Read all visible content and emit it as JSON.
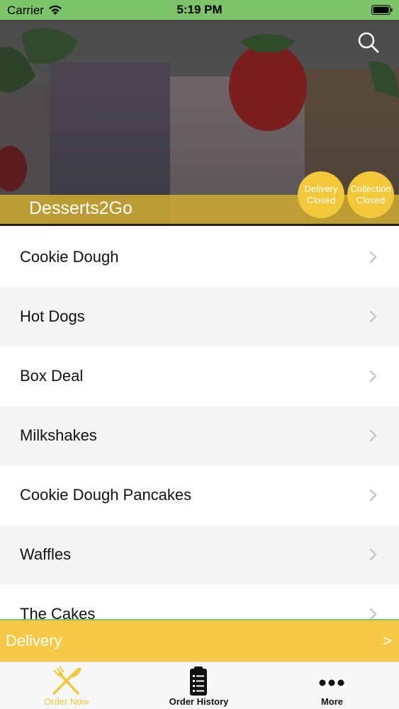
{
  "status_bar": {
    "carrier": "Carrier",
    "time": "5:19 PM"
  },
  "header": {
    "brand": "Desserts2Go",
    "badges": [
      {
        "line1": "Delivery",
        "line2": "Closed"
      },
      {
        "line1": "Collection",
        "line2": "Closed"
      }
    ]
  },
  "menu": {
    "items": [
      {
        "label": "Cookie Dough"
      },
      {
        "label": "Hot Dogs"
      },
      {
        "label": "Box Deal"
      },
      {
        "label": "Milkshakes"
      },
      {
        "label": "Cookie Dough Pancakes"
      },
      {
        "label": "Waffles"
      },
      {
        "label": "The Cakes"
      }
    ]
  },
  "delivery_bar": {
    "label": "Delivery",
    "arrow": ">"
  },
  "tabs": [
    {
      "label": "Order Now",
      "icon": "fork-knife-icon",
      "active": true
    },
    {
      "label": "Order History",
      "icon": "clipboard-list-icon",
      "active": false
    },
    {
      "label": "More",
      "icon": "more-dots-icon",
      "active": false
    }
  ],
  "colors": {
    "accent": "#f2c83a",
    "status_bar": "#7cc36a",
    "delivery_bar": "#f5c945"
  }
}
